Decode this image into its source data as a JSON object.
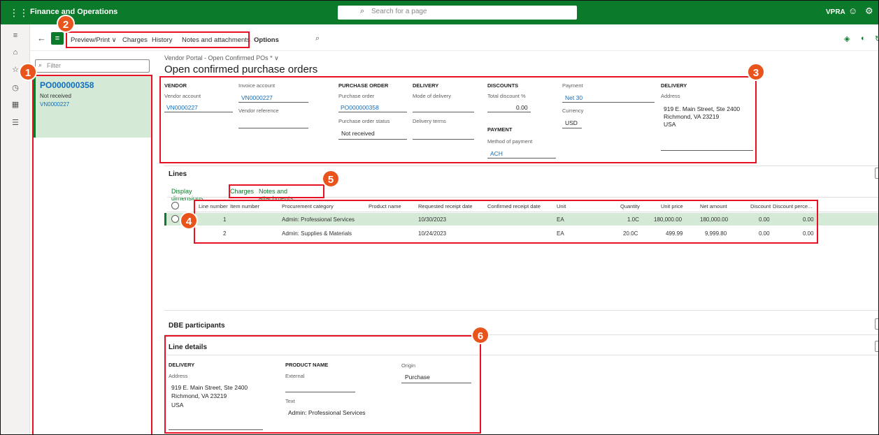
{
  "topbar": {
    "app_title": "Finance and Operations",
    "search_placeholder": "Search for a page",
    "company": "VPRA"
  },
  "action_pane": {
    "preview_print": "Preview/Print",
    "charges": "Charges",
    "history": "History",
    "notes": "Notes and attachments",
    "options": "Options"
  },
  "list": {
    "filter_placeholder": "Filter",
    "card": {
      "po": "PO000000358",
      "status": "Not received",
      "vendor": "VN0000227"
    }
  },
  "form": {
    "breadcrumb": "Vendor Portal - Open Confirmed POs * ∨",
    "title": "Open confirmed purchase orders",
    "vendor": {
      "header": "VENDOR",
      "vendor_account_label": "Vendor account",
      "vendor_account": "VN0000227",
      "invoice_account_label": "Invoice account",
      "invoice_account": "VN0000227",
      "vendor_reference_label": "Vendor reference"
    },
    "purchase_order": {
      "header": "PURCHASE ORDER",
      "po_label": "Purchase order",
      "po": "PO000000358",
      "status_label": "Purchase order status",
      "status": "Not received"
    },
    "delivery_mid": {
      "header": "DELIVERY",
      "mode_label": "Mode of delivery",
      "terms_label": "Delivery terms"
    },
    "discounts": {
      "header": "DISCOUNTS",
      "total_label": "Total discount %",
      "total": "0.00"
    },
    "payment_section": {
      "header": "PAYMENT",
      "method_label": "Method of payment",
      "method": "ACH"
    },
    "payment": {
      "label": "Payment",
      "value": "Net 30",
      "currency_label": "Currency",
      "currency": "USD"
    },
    "delivery": {
      "header": "DELIVERY",
      "address_label": "Address",
      "line1": "919 E. Main Street, Ste 2400",
      "line2": "Richmond, VA 23219",
      "line3": "USA"
    }
  },
  "lines": {
    "title": "Lines",
    "tabs": [
      "Display dimensions",
      "Charges",
      "Notes and attachments"
    ],
    "columns": [
      "Line number",
      "Item number",
      "Procurement category",
      "Product name",
      "Requested receipt date",
      "Confirmed receipt date",
      "Unit",
      "Quantity",
      "Unit price",
      "Net amount",
      "Discount",
      "Discount perce..."
    ],
    "rows": [
      {
        "line": "1",
        "item": "",
        "category": "Admin: Professional Services",
        "product": "",
        "requested": "10/30/2023",
        "confirmed": "",
        "unit": "EA",
        "qty": "1.0C",
        "price": "180,000.00",
        "net": "180,000.00",
        "discount": "0.00",
        "discount_pct": "0.00"
      },
      {
        "line": "2",
        "item": "",
        "category": "Admin: Supplies & Materials",
        "product": "",
        "requested": "10/24/2023",
        "confirmed": "",
        "unit": "EA",
        "qty": "20.0C",
        "price": "499.99",
        "net": "9,999.80",
        "discount": "0.00",
        "discount_pct": "0.00"
      }
    ]
  },
  "dbe": {
    "title": "DBE participants"
  },
  "line_details": {
    "title": "Line details",
    "delivery_header": "DELIVERY",
    "address_label": "Address",
    "line1": "919 E. Main Street, Ste 2400",
    "line2": "Richmond, VA 23219",
    "line3": "USA",
    "product_header": "PRODUCT NAME",
    "external_label": "External",
    "text_label": "Text",
    "text": "Admin: Professional Services",
    "origin_label": "Origin",
    "origin": "Purchase"
  },
  "callouts": [
    "1",
    "2",
    "3",
    "4",
    "5",
    "6"
  ],
  "colors": {
    "brand": "#0b7a2b",
    "callout": "#e81123",
    "badge": "#e8541c",
    "selected_row": "#d4ead7",
    "link": "#106ebe"
  }
}
